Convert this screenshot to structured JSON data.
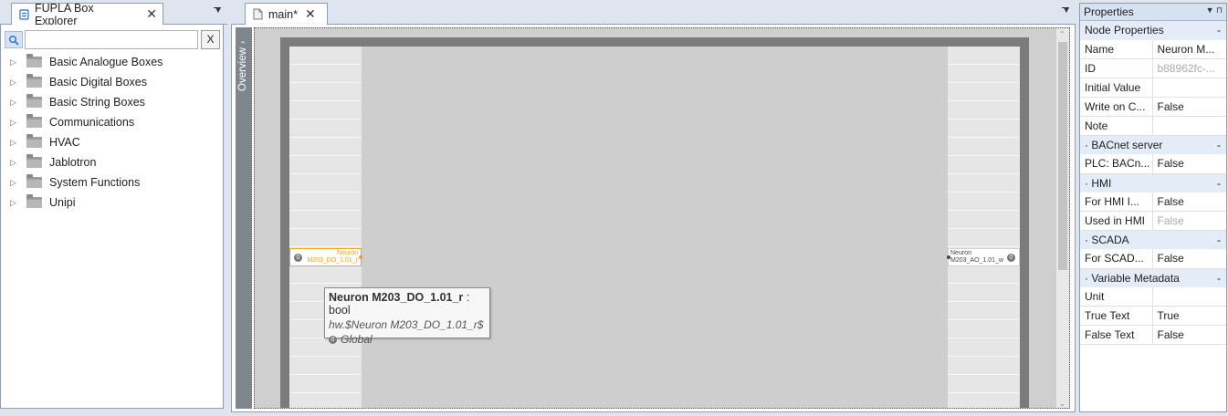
{
  "explorer": {
    "tab_title": "FUPLA Box Explorer",
    "search_value": "",
    "clear_label": "X",
    "items": [
      {
        "label": "Basic Analogue Boxes"
      },
      {
        "label": "Basic Digital Boxes"
      },
      {
        "label": "Basic String Boxes"
      },
      {
        "label": "Communications"
      },
      {
        "label": "HVAC"
      },
      {
        "label": "Jablotron"
      },
      {
        "label": "System Functions"
      },
      {
        "label": "Unipi"
      }
    ]
  },
  "document": {
    "tab_title": "main*",
    "overview_label": "Overview",
    "input_block": {
      "number": "0",
      "line1": "Neuron",
      "line2": "M203_DO_1.01_r"
    },
    "output_block": {
      "number": "0",
      "line1": "Neuron",
      "line2": "M203_AO_1.01_w"
    },
    "tooltip": {
      "name": "Neuron M203_DO_1.01_r",
      "type": " : bool",
      "path": "hw.$Neuron M203_DO_1.01_r$",
      "scope_number": "0",
      "scope": "Global"
    }
  },
  "properties": {
    "title": "Properties",
    "sections": [
      {
        "title": "Node Properties",
        "rows": [
          {
            "key": "Name",
            "value": "Neuron M...",
            "muted": false
          },
          {
            "key": "ID",
            "value": "b88962fc-...",
            "muted": true
          },
          {
            "key": "Initial Value",
            "value": "",
            "muted": false
          },
          {
            "key": "Write on C...",
            "value": "False",
            "muted": false
          },
          {
            "key": "Note",
            "value": "",
            "muted": false
          }
        ]
      },
      {
        "title": "BACnet server",
        "rows": [
          {
            "key": "PLC: BACn...",
            "value": "False",
            "muted": false
          }
        ]
      },
      {
        "title": "HMI",
        "rows": [
          {
            "key": "For HMI I...",
            "value": "False",
            "muted": false
          },
          {
            "key": "Used in HMI",
            "value": "False",
            "muted": true
          }
        ]
      },
      {
        "title": "SCADA",
        "rows": [
          {
            "key": "For SCAD...",
            "value": "False",
            "muted": false
          }
        ]
      },
      {
        "title": "Variable Metadata",
        "rows": [
          {
            "key": "Unit",
            "value": "",
            "muted": false
          },
          {
            "key": "True Text",
            "value": "True",
            "muted": false
          },
          {
            "key": "False Text",
            "value": "False",
            "muted": false
          }
        ]
      }
    ]
  }
}
